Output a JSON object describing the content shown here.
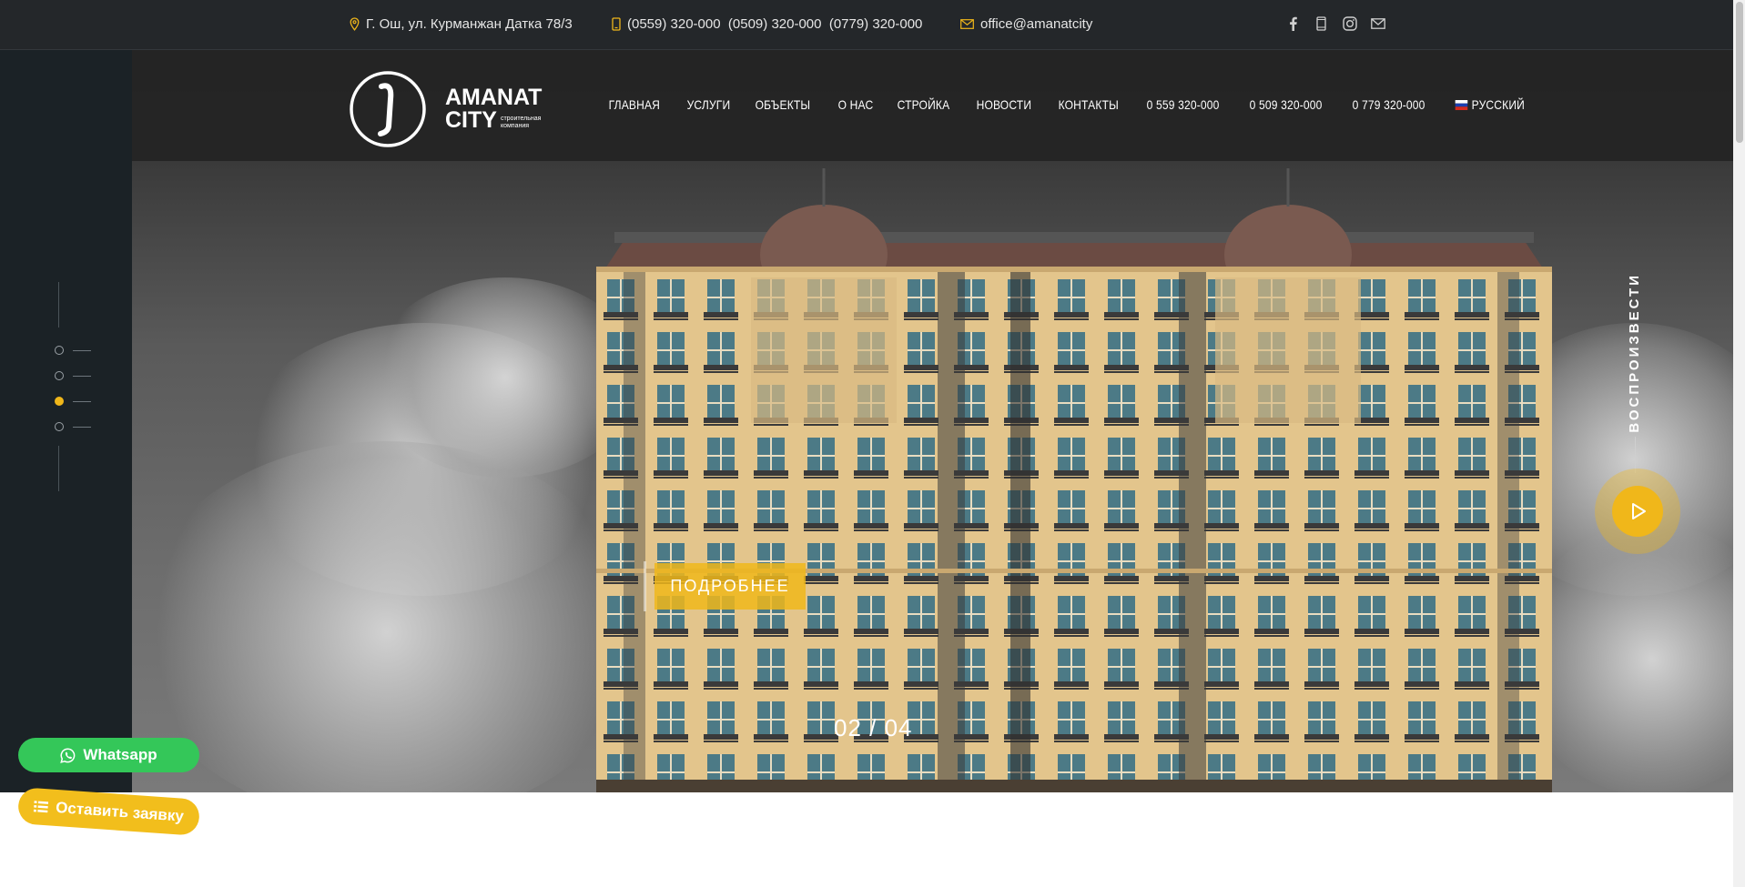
{
  "topbar": {
    "address": "Г. Ош, ул. Курманжан Датка 78/3",
    "phones": "(0559) 320-000  (0509) 320-000  (0779) 320-000",
    "email": "office@amanatcity",
    "social_icons": [
      "facebook-icon",
      "phone-icon",
      "instagram-icon",
      "mail-icon"
    ]
  },
  "logo": {
    "line1": "AMANAT",
    "line2": "CITY",
    "tagline1": "строительная",
    "tagline2": "компания"
  },
  "nav": {
    "items": [
      "ГЛАВНАЯ",
      "УСЛУГИ",
      "ОБЪЕКТЫ",
      "О НАС",
      "СТРОЙКА",
      "НОВОСТИ",
      "КОНТАКТЫ",
      "0 559 320-000",
      "0 509 320-000",
      "0 779 320-000"
    ],
    "language": "РУССКИЙ"
  },
  "hero": {
    "more_button": "ПОДРОБНЕЕ",
    "counter": "02 / 04",
    "play_label": "ВОСПРОИЗВЕСТИ",
    "active_slide": 3,
    "slides_total": 4
  },
  "floating": {
    "whatsapp": "Whatsapp",
    "request": "Оставить заявку"
  },
  "colors": {
    "accent": "#f0b71a",
    "whatsapp": "#34c759",
    "topbar": "#24272a",
    "rail": "#1b2226"
  }
}
